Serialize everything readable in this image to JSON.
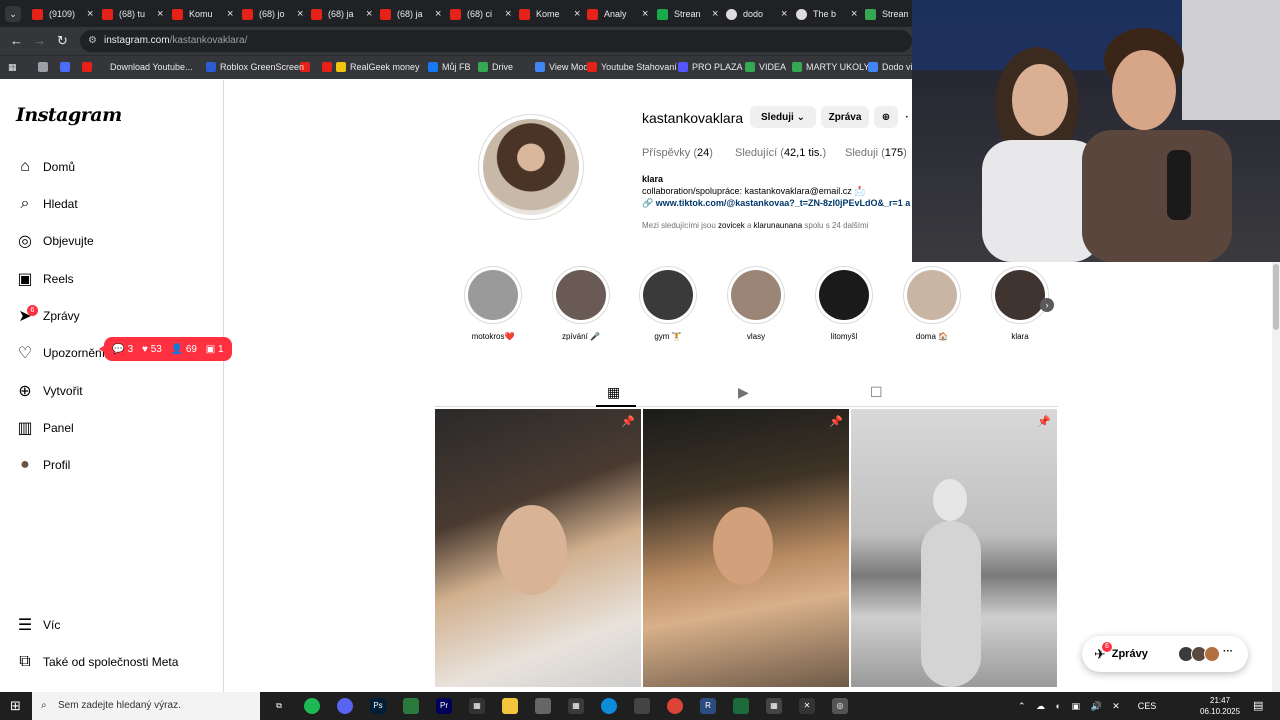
{
  "browser": {
    "tabs": [
      {
        "title": "(9109)",
        "icon": "youtube-icon"
      },
      {
        "title": "(68) tu",
        "icon": "youtube-icon"
      },
      {
        "title": "Komu",
        "icon": "youtube-icon"
      },
      {
        "title": "(68) jo",
        "icon": "youtube-icon"
      },
      {
        "title": "(68) ja",
        "icon": "youtube-icon"
      },
      {
        "title": "(68) ja",
        "icon": "youtube-icon"
      },
      {
        "title": "(68) ci",
        "icon": "youtube-icon"
      },
      {
        "title": "Kome",
        "icon": "youtube-icon"
      },
      {
        "title": "Analy",
        "icon": "youtube-icon"
      },
      {
        "title": "Strean",
        "icon": "kick-icon"
      },
      {
        "title": "dodo",
        "icon": "github-icon"
      },
      {
        "title": "The b",
        "icon": "github-icon"
      },
      {
        "title": "Stream",
        "icon": "chart-icon"
      }
    ],
    "url_host": "instagram.com",
    "url_path": "/kastankovaklara/",
    "bookmarks": [
      "Download Youtube...",
      "Roblox GreenScreen",
      "RealGeek money",
      "Můj FB",
      "Drive",
      "View Mode",
      "Youtube Stahovaní",
      "PRO PLAZA",
      "VIDEA",
      "MARTY UKOLY",
      "Dodo vid"
    ]
  },
  "sidebar": {
    "logo": "Instagram",
    "items": [
      {
        "label": "Domů",
        "icon": "home-icon"
      },
      {
        "label": "Hledat",
        "icon": "search-icon"
      },
      {
        "label": "Objevujte",
        "icon": "compass-icon"
      },
      {
        "label": "Reels",
        "icon": "reels-icon"
      },
      {
        "label": "Zprávy",
        "icon": "messenger-icon"
      },
      {
        "label": "Upozornění",
        "icon": "heart-icon"
      },
      {
        "label": "Vytvořit",
        "icon": "plus-icon"
      },
      {
        "label": "Panel",
        "icon": "dashboard-icon"
      },
      {
        "label": "Profil",
        "icon": "avatar-icon"
      }
    ],
    "messages_badge": "6",
    "more_label": "Víc",
    "meta_label": "Také od společnosti Meta",
    "notifications_popup": {
      "comments": "3",
      "likes": "53",
      "followers": "69",
      "requests": "1"
    }
  },
  "profile": {
    "username": "kastankovaklara",
    "follow_button": "Sleduji",
    "message_button": "Zpráva",
    "stats": {
      "posts_label": "Příspěvky",
      "posts_count": "24",
      "followers_label": "Sledující",
      "followers_count": "42,1 tis.",
      "following_label": "Sleduji",
      "following_count": "175"
    },
    "name": "klara",
    "bio_line": "collaboration/spolupráce: kastankovaklara@email.cz 📩",
    "link": "www.tiktok.com/@kastankovaa?_t=ZN-8zI0jPEvLdO&_r=1 a",
    "mutual_prefix": "Mezi sledujícími jsou",
    "mutual_user1": "zovicek",
    "mutual_and": "a",
    "mutual_user2": "klarunaunana",
    "mutual_suffix": "spolu s 24 dalšími"
  },
  "highlights": [
    {
      "label": "motokros❤️",
      "color": "#9a9a9a"
    },
    {
      "label": "zpívání 🎤",
      "color": "#6a5a55"
    },
    {
      "label": "gym 🏋️",
      "color": "#3a3a3a"
    },
    {
      "label": "vlasy",
      "color": "#9b8576"
    },
    {
      "label": "litomyšl",
      "color": "#1a1a1a"
    },
    {
      "label": "doma 🏠",
      "color": "#c9b5a4"
    },
    {
      "label": "klara",
      "color": "#3f3430"
    }
  ],
  "post_tabs": [
    "posts-tab",
    "reels-tab",
    "tagged-tab"
  ],
  "messages_dock": {
    "label": "Zprávy",
    "badge": "6"
  },
  "taskbar": {
    "search_placeholder": "Sem zadejte hledaný výraz.",
    "language": "CES",
    "time": "21:47",
    "date": "06.10.2025"
  }
}
